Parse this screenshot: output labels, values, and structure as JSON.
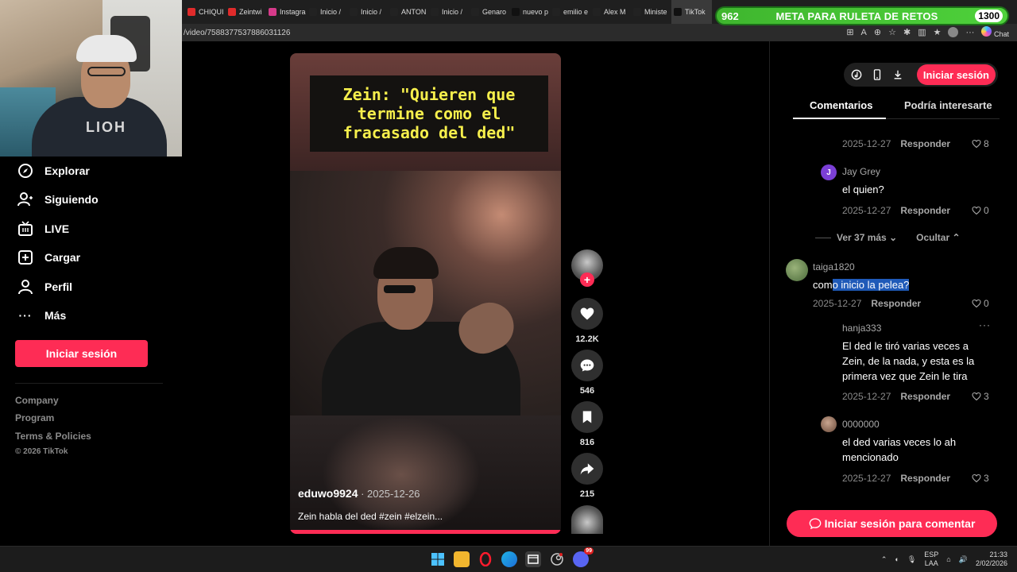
{
  "browser": {
    "tabs": [
      {
        "label": "CHIQUI",
        "fav_color": "#e02b2b"
      },
      {
        "label": "Zeintwi",
        "fav_color": "#e02b2b"
      },
      {
        "label": "Instagra",
        "fav_color": "#d63a8a"
      },
      {
        "label": "Inicio /",
        "fav_color": "#222222"
      },
      {
        "label": "Inicio /",
        "fav_color": "#222222"
      },
      {
        "label": "ANTON",
        "fav_color": "#222222"
      },
      {
        "label": "Inicio /",
        "fav_color": "#222222"
      },
      {
        "label": "Genaro",
        "fav_color": "#222222"
      },
      {
        "label": "nuevo p",
        "fav_color": "#111111"
      },
      {
        "label": "emilio e",
        "fav_color": "#222222"
      },
      {
        "label": "Alex M",
        "fav_color": "#222222"
      },
      {
        "label": "Ministe",
        "fav_color": "#222222"
      },
      {
        "label": "TikTok",
        "fav_color": "#111111"
      }
    ],
    "url": "/video/7588377537886031126",
    "chat_label": "Chat"
  },
  "goal_overlay": {
    "start": "962",
    "title": "META PARA RULETA DE RETOS",
    "end": "1300"
  },
  "webcam": {
    "shirt_text": "LIOH"
  },
  "sidebar": {
    "nav": [
      {
        "label": "Explorar",
        "icon": "compass-icon"
      },
      {
        "label": "Siguiendo",
        "icon": "user-follow-icon"
      },
      {
        "label": "LIVE",
        "icon": "live-tv-icon"
      },
      {
        "label": "Cargar",
        "icon": "upload-plus-icon"
      },
      {
        "label": "Perfil",
        "icon": "profile-icon"
      },
      {
        "label": "Más",
        "icon": "more-dots-icon"
      }
    ],
    "login_label": "Iniciar sesión",
    "footer": [
      "Company",
      "Program",
      "Terms & Policies"
    ],
    "copyright": "© 2026 TikTok"
  },
  "video": {
    "caption": "Zein: \"Quieren que termine como el fracasado del ded\"",
    "author": "eduwo9924",
    "date": " · 2025-12-26",
    "description": "Zein habla del ded #zein #elzein...",
    "likes": "12.2K",
    "comments": "546",
    "saves": "816",
    "shares": "215"
  },
  "panel": {
    "login_label": "Iniciar sesión",
    "tabs": [
      "Comentarios",
      "Podría interesarte"
    ],
    "reply_label": "Responder",
    "comment0": {
      "date": "2025-12-27",
      "likes": "8"
    },
    "comment1": {
      "user": "Jay Grey",
      "initial": "J",
      "text": "el quien?",
      "date": "2025-12-27",
      "likes": "0"
    },
    "expand": {
      "more": "Ver 37 más",
      "hide": "Ocultar"
    },
    "comment2": {
      "user": "taiga1820",
      "text_plain": "com",
      "text_highlight": "o inicio la pelea?",
      "date": "2025-12-27",
      "likes": "0"
    },
    "comment3": {
      "user": "hanja333",
      "text": "El ded le tiró varias veces a Zein, de la nada, y esta es la primera vez que Zein le tira",
      "date": "2025-12-27",
      "likes": "3"
    },
    "comment4": {
      "user": "0000000",
      "text": "el ded varias veces lo ah mencionado",
      "date": "2025-12-27",
      "likes": "3"
    },
    "comment_login_label": "Iniciar sesión para comentar"
  },
  "taskbar": {
    "lang_top": "ESP",
    "lang_bottom": "LAA",
    "time": "21:33",
    "date": "2/02/2026",
    "discord_badge": "99"
  },
  "colors": {
    "accent": "#fe2c55",
    "goal_green": "#4ed13b",
    "caption_yellow": "#f6ef4c"
  }
}
